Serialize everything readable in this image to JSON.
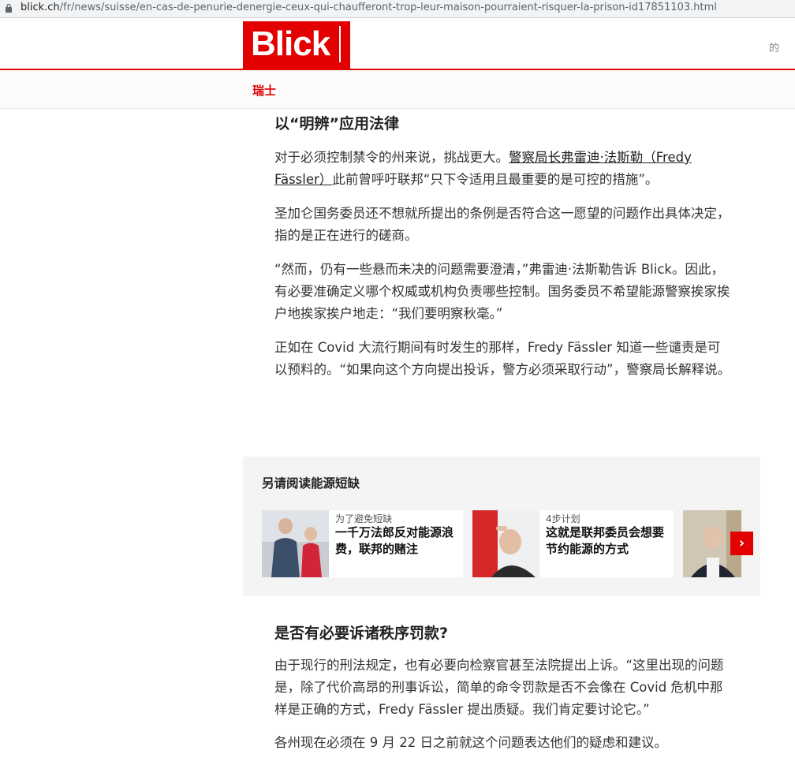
{
  "browser": {
    "url_host": "blick.ch",
    "url_path": "/fr/news/suisse/en-cas-de-penurie-denergie-ceux-qui-chaufferont-trop-leur-maison-pourraient-risquer-la-prison-id17851103.html"
  },
  "header": {
    "logo_text": "Blick",
    "right_text": "的",
    "brand_color": "#e20000"
  },
  "section": {
    "label": "瑞士"
  },
  "article": {
    "heading1": "以“明辨”应用法律",
    "p1_pre": "对于必须控制禁令的州来说，挑战更大。",
    "p1_link": "警察局长弗雷迪·法斯勒（Fredy Fässler）",
    "p1_post": "此前曾呼吁联邦“只下令适用且最重要的是可控的措施”。",
    "p2": "圣加仑国务委员还不想就所提出的条例是否符合这一愿望的问题作出具体决定，指的是正在进行的磋商。",
    "p3": "“然而，仍有一些悬而未决的问题需要澄清，”弗雷迪·法斯勒告诉 Blick。因此，有必要准确定义哪个权威或机构负责哪些控制。国务委员不希望能源警察挨家挨户地挨家挨户地走：“我们要明察秋毫。”",
    "p4": "正如在 Covid 大流行期间有时发生的那样，Fredy Fässler 知道一些谴责是可以预料的。“如果向这个方向提出投诉，警方必须采取行动”，警察局长解释说。",
    "heading2": "是否有必要诉诸秩序罚款?",
    "p5": "由于现行的刑法规定，也有必要向检察官甚至法院提出上诉。“这里出现的问题是，除了代价高昂的刑事诉讼，简单的命令罚款是否不会像在 Covid 危机中那样是正确的方式，Fredy Fässler 提出质疑。我们肯定要讨论它。”",
    "p6": "各州现在必须在 9 月 22 日之前就这个问题表达他们的疑虑和建议。"
  },
  "related": {
    "title": "另请阅读能源短缺",
    "cards": [
      {
        "kicker": "为了避免短缺",
        "headline": "一千万法郎反对能源浪费，联邦的赌注"
      },
      {
        "kicker": "4步计划",
        "headline": "这就是联邦委员会想要节约能源的方式"
      },
      {
        "kicker": "",
        "headline": ""
      }
    ],
    "next_icon": "chevron-right-icon"
  }
}
